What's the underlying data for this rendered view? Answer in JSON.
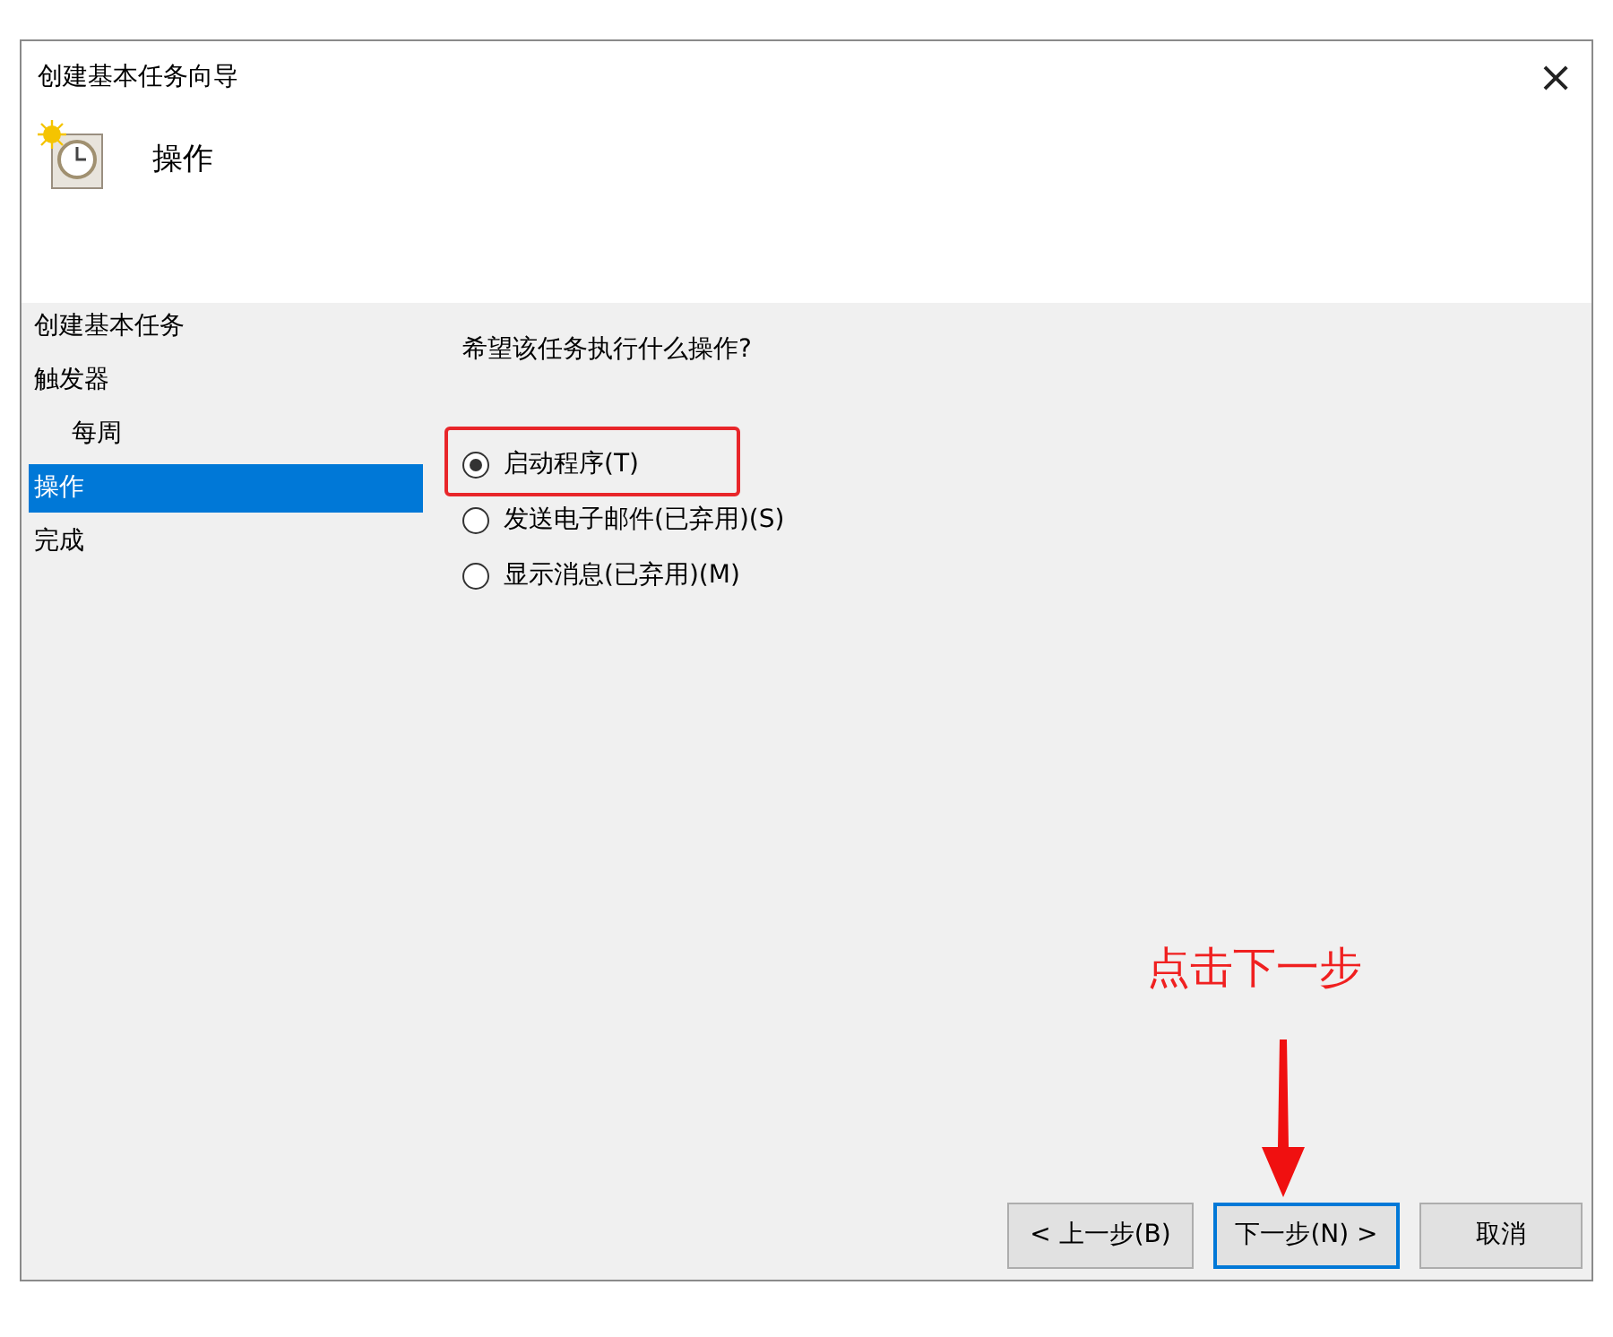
{
  "window": {
    "title": "创建基本任务向导",
    "close": "×"
  },
  "header": {
    "title": "操作"
  },
  "nav": [
    {
      "label": "创建基本任务",
      "selected": false
    },
    {
      "label": "触发器",
      "selected": false,
      "children": [
        {
          "label": "每周",
          "selected": false
        }
      ]
    },
    {
      "label": "操作",
      "selected": true
    },
    {
      "label": "完成",
      "selected": false
    }
  ],
  "question": "希望该任务执行什么操作?",
  "options": [
    {
      "label": "启动程序(T)",
      "selected": true,
      "highlighted": true
    },
    {
      "label": "发送电子邮件(已弃用)(S)",
      "selected": false,
      "highlighted": false
    },
    {
      "label": "显示消息(已弃用)(M)",
      "selected": false,
      "highlighted": false
    }
  ],
  "buttons": [
    {
      "label": "< 上一步(B)",
      "default": false
    },
    {
      "label": "下一步(N) >",
      "default": true
    },
    {
      "label": "取消",
      "default": false
    }
  ],
  "annotation": {
    "text": "点击下一步"
  }
}
